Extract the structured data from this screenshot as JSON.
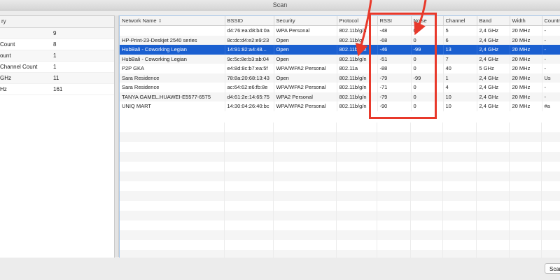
{
  "window": {
    "title": "Scan"
  },
  "summary": {
    "header": "ry",
    "rows": [
      {
        "key": "",
        "value": "9"
      },
      {
        "key": " Count",
        "value": "8"
      },
      {
        "key": "ount",
        "value": "1"
      },
      {
        "key": "Channel Count",
        "value": "1"
      },
      {
        "key": "GHz",
        "value": "11"
      },
      {
        "key": "Hz",
        "value": "161"
      }
    ]
  },
  "table": {
    "columns": [
      "Network Name",
      "BSSID",
      "Security",
      "Protocol",
      "RSSI",
      "Noise",
      "Channel",
      "Band",
      "Width",
      "Country"
    ],
    "sort_icon": "sort-updown-icon",
    "selected_row": 2,
    "rows": [
      [
        "",
        "d4:76:ea:d8:b4:0a",
        "WPA Personal",
        "802.11b/g/n",
        "-48",
        "0",
        "5",
        "2,4 GHz",
        "20 MHz",
        "-"
      ],
      [
        "HP-Print-23-Deskjet 2540 series",
        "8c:dc:d4:e2:e9:23",
        "Open",
        "802.11b/g",
        "-68",
        "0",
        "6",
        "2,4 GHz",
        "20 MHz",
        "-"
      ],
      [
        "HubBali - Coworking Legian",
        "14:91:82:a4:48...",
        "Open",
        "802.11b/g/n",
        "-46",
        "-99",
        "13",
        "2,4 GHz",
        "20 MHz",
        "-"
      ],
      [
        "HubBali - Coworking Legian",
        "9c:5c:8e:b3:ab:04",
        "Open",
        "802.11b/g/n",
        "-51",
        "0",
        "7",
        "2,4 GHz",
        "20 MHz",
        "-"
      ],
      [
        "P2P GKA",
        "e4:8d:8c:b7:ea:5f",
        "WPA/WPA2 Personal",
        "802.11a",
        "-88",
        "0",
        "40",
        "5 GHz",
        "20 MHz",
        "-"
      ],
      [
        "Sara Residence",
        "78:8a:20:68:13:43",
        "Open",
        "802.11b/g/n",
        "-79",
        "-99",
        "1",
        "2,4 GHz",
        "20 MHz",
        "Us"
      ],
      [
        "Sara Residence",
        "ac:64:62:e6:fb:8e",
        "WPA/WPA2 Personal",
        "802.11b/g/n",
        "-71",
        "0",
        "4",
        "2,4 GHz",
        "20 MHz",
        "-"
      ],
      [
        "TANYA GAMEL.HUAWEI-E5577-6575",
        "d4:61:2e:14:65:75",
        "WPA2 Personal",
        "802.11b/g/n",
        "-79",
        "0",
        "10",
        "2,4 GHz",
        "20 MHz",
        "-"
      ],
      [
        "UNIQ MART",
        "14:30:04:26:40:bc",
        "WPA/WPA2 Personal",
        "802.11b/g/n",
        "-90",
        "0",
        "10",
        "2,4 GHz",
        "20 MHz",
        "#a"
      ]
    ]
  },
  "annotation": {
    "color": "#e8392b",
    "highlight": "RSSI and Noise columns"
  },
  "footer": {
    "scan_button": "Scan"
  }
}
